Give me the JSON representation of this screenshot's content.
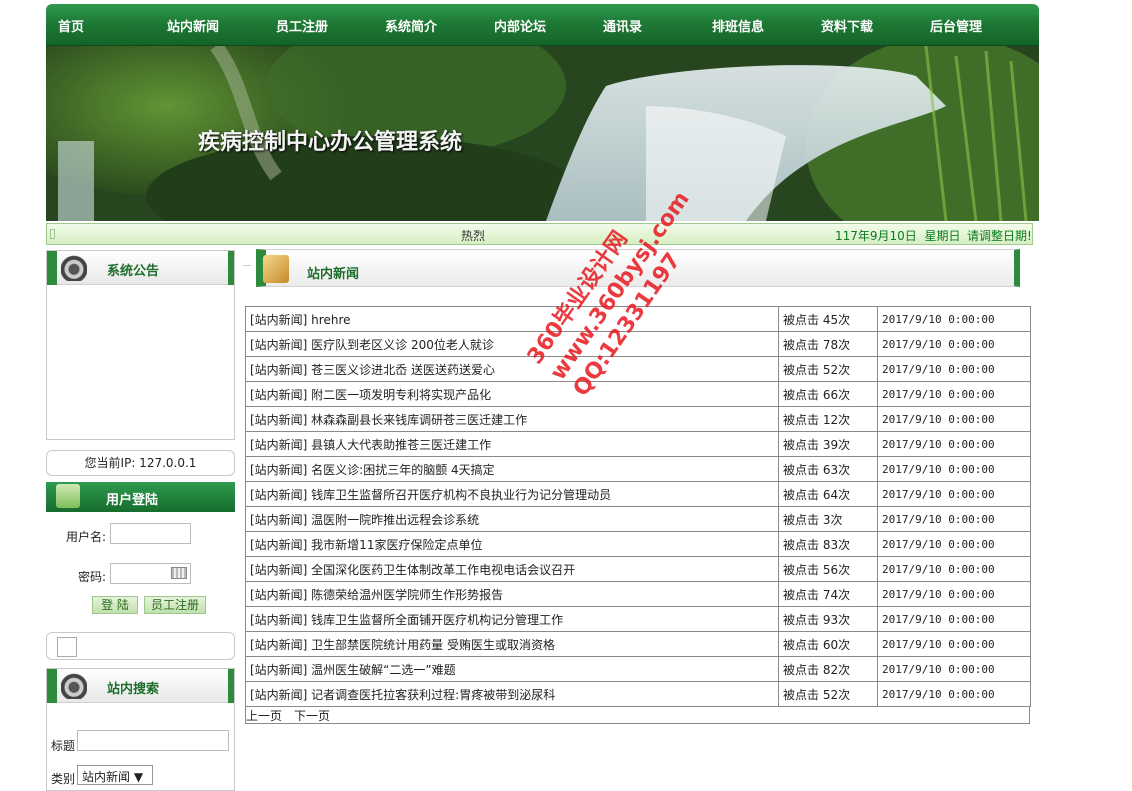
{
  "nav": {
    "items": [
      "首页",
      "站内新闻",
      "员工注册",
      "系统简介",
      "内部论坛",
      "通讯录",
      "排班信息",
      "资料下载",
      "后台管理"
    ]
  },
  "banner": {
    "title": "疾病控制中心办公管理系统"
  },
  "status": {
    "marquee": "热烈",
    "date": "117年9月10日",
    "weekday": "星期日",
    "adjust": "请调整日期!"
  },
  "left": {
    "announcement_title": "系统公告",
    "ip_text": "您当前IP: 127.0.0.1",
    "login": {
      "title": "用户登陆",
      "user_label": "用户名:",
      "pass_label": "密码:",
      "login_btn": "登 陆",
      "register_btn": "员工注册"
    },
    "search": {
      "title": "站内搜索",
      "title_label": "标题",
      "category_label": "类别",
      "category_value": "站内新闻 ▼"
    }
  },
  "news": {
    "title": "站内新闻",
    "rows": [
      {
        "title": "[站内新闻] hrehre",
        "clicks": "被点击 45次",
        "date": "2017/9/10 0:00:00"
      },
      {
        "title": "[站内新闻] 医疗队到老区义诊 200位老人就诊",
        "clicks": "被点击 78次",
        "date": "2017/9/10 0:00:00"
      },
      {
        "title": "[站内新闻] 苍三医义诊进北岙 送医送药送爱心",
        "clicks": "被点击 52次",
        "date": "2017/9/10 0:00:00"
      },
      {
        "title": "[站内新闻] 附二医一项发明专利将实现产品化",
        "clicks": "被点击 66次",
        "date": "2017/9/10 0:00:00"
      },
      {
        "title": "[站内新闻] 林森森副县长来钱库调研苍三医迁建工作",
        "clicks": "被点击 12次",
        "date": "2017/9/10 0:00:00"
      },
      {
        "title": "[站内新闻] 县镇人大代表助推苍三医迁建工作",
        "clicks": "被点击 39次",
        "date": "2017/9/10 0:00:00"
      },
      {
        "title": "[站内新闻] 名医义诊:困扰三年的脑颤 4天搞定",
        "clicks": "被点击 63次",
        "date": "2017/9/10 0:00:00"
      },
      {
        "title": "[站内新闻] 钱库卫生监督所召开医疗机构不良执业行为记分管理动员",
        "clicks": "被点击 64次",
        "date": "2017/9/10 0:00:00"
      },
      {
        "title": "[站内新闻] 温医附一院昨推出远程会诊系统",
        "clicks": "被点击 3次",
        "date": "2017/9/10 0:00:00"
      },
      {
        "title": "[站内新闻] 我市新增11家医疗保险定点单位",
        "clicks": "被点击 83次",
        "date": "2017/9/10 0:00:00"
      },
      {
        "title": "[站内新闻] 全国深化医药卫生体制改革工作电视电话会议召开",
        "clicks": "被点击 56次",
        "date": "2017/9/10 0:00:00"
      },
      {
        "title": "[站内新闻] 陈德荣给温州医学院师生作形势报告",
        "clicks": "被点击 74次",
        "date": "2017/9/10 0:00:00"
      },
      {
        "title": "[站内新闻] 钱库卫生监督所全面铺开医疗机构记分管理工作",
        "clicks": "被点击 93次",
        "date": "2017/9/10 0:00:00"
      },
      {
        "title": "[站内新闻] 卫生部禁医院统计用药量 受贿医生或取消资格",
        "clicks": "被点击 60次",
        "date": "2017/9/10 0:00:00"
      },
      {
        "title": "[站内新闻] 温州医生破解“二选一”难题",
        "clicks": "被点击 82次",
        "date": "2017/9/10 0:00:00"
      },
      {
        "title": "[站内新闻] 记者调查医托拉客获利过程:胃疼被带到泌尿科",
        "clicks": "被点击 52次",
        "date": "2017/9/10 0:00:00"
      }
    ],
    "prev": "上一页",
    "next": "下一页"
  },
  "watermark": {
    "line1": "360毕业设计网",
    "line2": "www.360bysj.com",
    "line3": "QQ:12331197"
  },
  "colors": {
    "nav_green": "#1e7a36",
    "accent_green": "#2e8b3e",
    "date_green": "#0b7a1f",
    "watermark_red": "#e8181f"
  }
}
